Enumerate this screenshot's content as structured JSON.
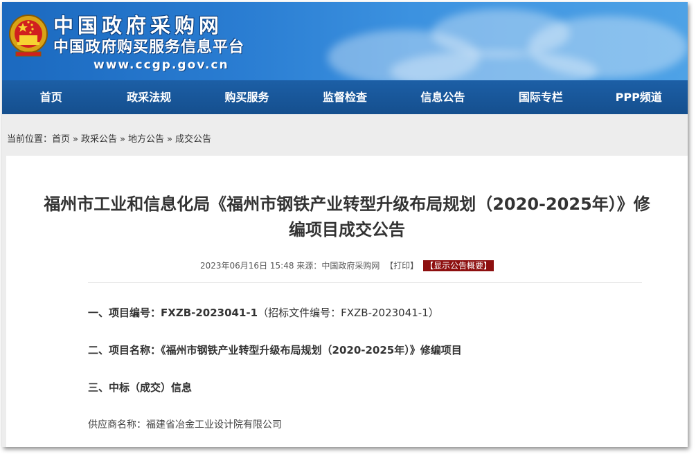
{
  "site": {
    "name": "中国政府采购网",
    "subtitle": "中国政府购买服务信息平台",
    "url": "www.ccgp.gov.cn",
    "emblem_icon": "national-emblem",
    "colors": {
      "banner": "#2a7dd2",
      "nav": "#1b5a9e",
      "badge": "#8d0f0f"
    }
  },
  "nav": {
    "items": [
      {
        "label": "首页"
      },
      {
        "label": "政采法规"
      },
      {
        "label": "购买服务"
      },
      {
        "label": "监督检查"
      },
      {
        "label": "信息公告"
      },
      {
        "label": "国际专栏"
      },
      {
        "label": "PPP频道"
      }
    ]
  },
  "breadcrumb": {
    "prefix": "当前位置：",
    "items": [
      "首页",
      "政采公告",
      "地方公告",
      "成交公告"
    ],
    "separator": "»"
  },
  "article": {
    "title_line1": "福州市工业和信息化局《福州市钢铁产业转型升级布局规划（2020-2025年）》修",
    "title_line2": "编项目成交公告",
    "meta": {
      "datetime": "2023年06月16日 15:48",
      "source_label": "来源：",
      "source": "中国政府采购网",
      "print": "【打印】",
      "summary": "【显示公告概要】"
    },
    "sections": {
      "s1_label": "一、项目编号：",
      "s1_value": "FXZB-2023041-1",
      "s1_note": "（招标文件编号：FXZB-2023041-1）",
      "s2_label": "二、项目名称：",
      "s2_value": "《福州市钢铁产业转型升级布局规划（2020-2025年）》修编项目",
      "s3_label": "三、中标（成交）信息"
    },
    "supplier_label": "供应商名称：",
    "supplier_value": "福建省冶金工业设计院有限公司"
  }
}
